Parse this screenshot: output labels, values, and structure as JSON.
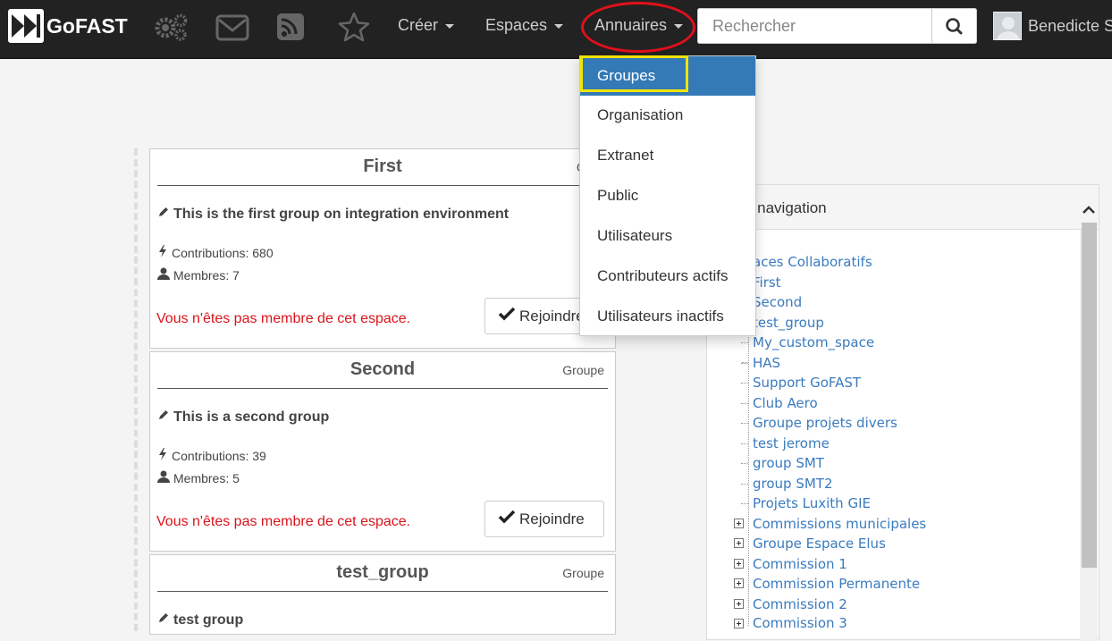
{
  "brand": {
    "name": "GoFAST"
  },
  "topbar": {
    "icons": [
      "settings-gears-icon",
      "mail-icon",
      "rss-icon",
      "star-icon"
    ],
    "menus": {
      "create": "Créer",
      "spaces": "Espaces",
      "directories": "Annuaires"
    },
    "search": {
      "placeholder": "Rechercher"
    },
    "user": {
      "name": "Benedicte S"
    }
  },
  "dropdown": {
    "items": [
      "Groupes",
      "Organisation",
      "Extranet",
      "Public",
      "Utilisateurs",
      "Contributeurs actifs",
      "Utilisateurs inactifs"
    ],
    "active": "Groupes"
  },
  "cards": [
    {
      "title": "First",
      "type": "Grou",
      "description": "This is the first group on integration environment",
      "contributions": "Contributions: 680",
      "members": "Membres: 7",
      "status": "Vous n'êtes pas membre de cet espace.",
      "button": "Rejoindre"
    },
    {
      "title": "Second",
      "type": "Groupe",
      "description": "This is a second group",
      "contributions": "Contributions: 39",
      "members": "Membres: 5",
      "status": "Vous n'êtes pas membre de cet espace.",
      "button": "Rejoindre"
    },
    {
      "title": "test_group",
      "type": "Groupe",
      "description": "test group"
    }
  ],
  "groups_navigation": {
    "title": "ups navigation",
    "root": "aces Collaboratifs",
    "items": [
      "First",
      "Second",
      "test_group",
      "My_custom_space",
      "HAS",
      "Support GoFAST",
      "Club Aero",
      "Groupe projets divers",
      "test jerome",
      "group SMT",
      "group SMT2",
      "Projets Luxith GIE"
    ],
    "expandable_items": [
      "Commissions municipales",
      "Groupe Espace Elus",
      "Commission 1",
      "Commission Permanente",
      "Commission 2",
      "Commission 3"
    ]
  },
  "colors": {
    "topbar": "#222222",
    "link": "#3a7bbf",
    "active": "#337ab7",
    "warning": "#d9141b",
    "annotation_red": "#e0101a",
    "annotation_yellow": "#f2e400"
  }
}
